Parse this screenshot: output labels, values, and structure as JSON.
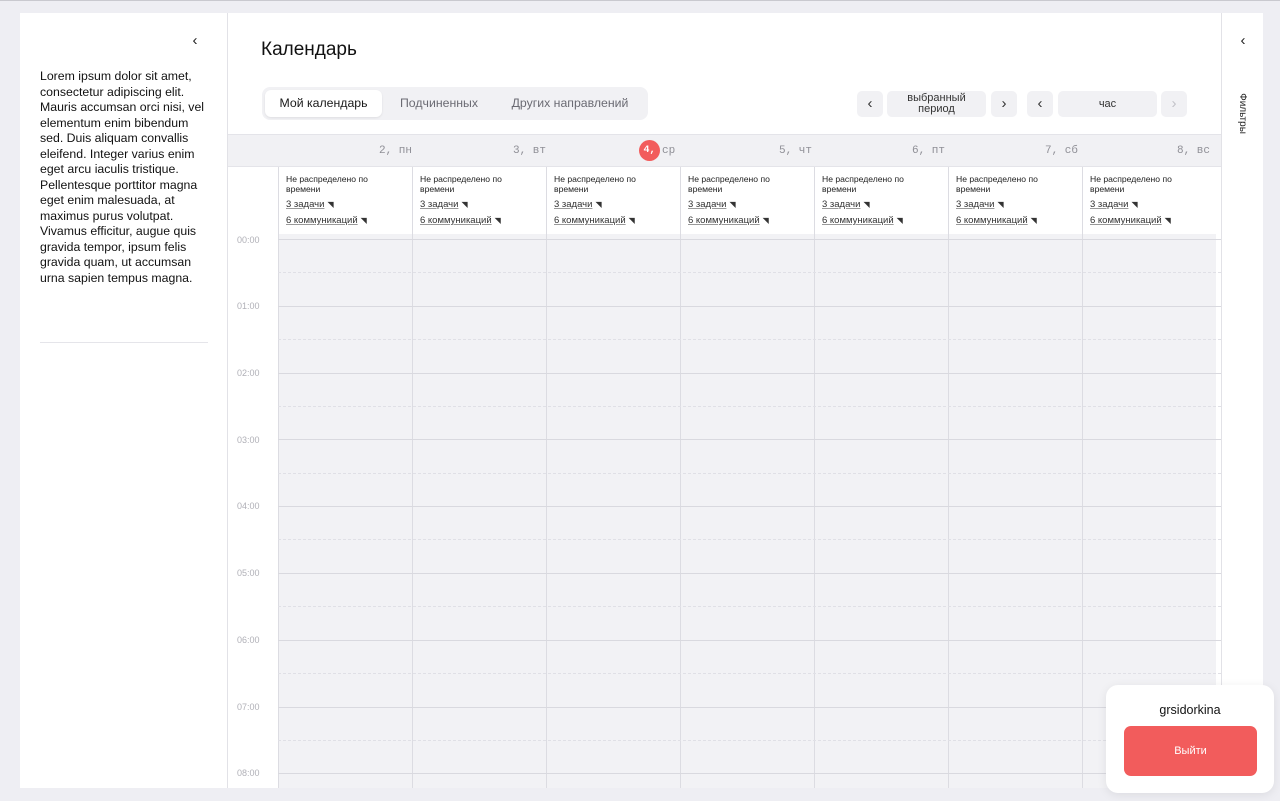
{
  "sidebar": {
    "collapse_icon": "chevron-left-icon",
    "text": "Lorem ipsum dolor sit amet, consectetur adipiscing elit. Mauris accumsan orci nisi, vel elementum enim bibendum sed. Duis aliquam convallis eleifend. Integer varius enim eget arcu iaculis tristique. Pellentesque porttitor magna eget enim malesuada, at maximus purus volutpat. Vivamus efficitur, augue quis gravida tempor, ipsum felis gravida quam, ut accumsan urna sapien tempus magna."
  },
  "header": {
    "title": "Календарь",
    "tabs": [
      {
        "label": "Мой календарь",
        "active": true
      },
      {
        "label": "Подчиненных",
        "active": false
      },
      {
        "label": "Других направлений",
        "active": false
      }
    ],
    "period_label": "выбранный период",
    "scale_label": "час",
    "prev_icon": "chevron-left-icon",
    "next_icon": "chevron-right-icon"
  },
  "days": [
    {
      "label": "2, пн",
      "today": false
    },
    {
      "label": "3, вт",
      "today": false
    },
    {
      "label": "4,",
      "weekday": "ср",
      "today": true
    },
    {
      "label": "5, чт",
      "today": false
    },
    {
      "label": "6, пт",
      "today": false
    },
    {
      "label": "7, сб",
      "today": false
    },
    {
      "label": "8, вс",
      "today": false
    }
  ],
  "day_summary": {
    "title": "Не распределено по времени",
    "tasks": "3 задачи",
    "communications": "6 коммуникаций",
    "link_icon": "arrow-up-right-icon"
  },
  "hours": [
    "00:00",
    "01:00",
    "02:00",
    "03:00",
    "04:00",
    "05:00",
    "06:00",
    "07:00",
    "08:00"
  ],
  "filters_panel": {
    "label": "Фильтры",
    "collapse_icon": "chevron-left-icon"
  },
  "user": {
    "username": "grsidorkina",
    "logout_label": "Выйти"
  },
  "colors": {
    "accent": "#f25c5c",
    "background": "#eeeef3",
    "grid": "#f2f2f5"
  }
}
